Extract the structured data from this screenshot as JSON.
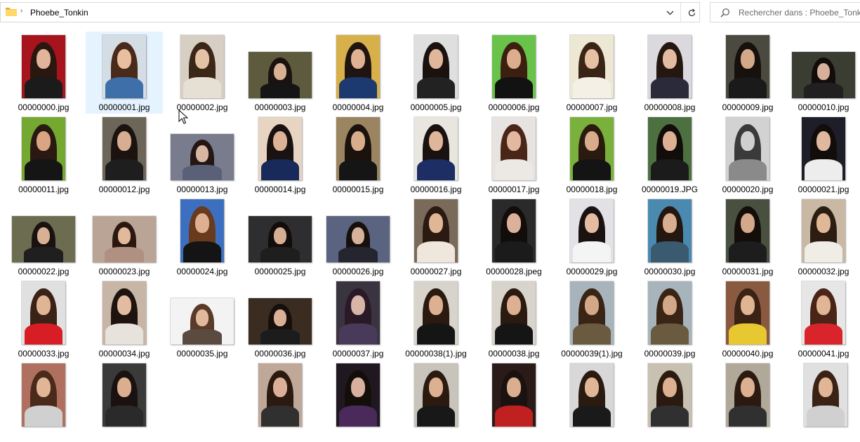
{
  "address": {
    "folder_icon": "folder-icon",
    "breadcrumb": "Phoebe_Tonkin"
  },
  "search": {
    "placeholder": "Rechercher dans : Phoebe_Tonkin"
  },
  "colors": {
    "selection": "#e5f3ff",
    "folder": "#f4c64d"
  },
  "files": [
    {
      "name": "00000000.jpg",
      "bg": "#a8141e",
      "skin": "#e2b49a",
      "hair": "#2a1710",
      "top": "#1b1b1b",
      "thumb": "p"
    },
    {
      "name": "00000001.jpg",
      "bg": "#d4dde4",
      "skin": "#eabf9f",
      "hair": "#4a2a1a",
      "top": "#3f6fa8",
      "thumb": "p",
      "selected": true
    },
    {
      "name": "00000002.jpg",
      "bg": "#d8cfc4",
      "skin": "#e4c2a6",
      "hair": "#3a2718",
      "top": "#e6e0d4",
      "thumb": "p"
    },
    {
      "name": "00000003.jpg",
      "bg": "#5e5a3e",
      "skin": "#d8b094",
      "hair": "#1a1210",
      "top": "#151515",
      "thumb": "l"
    },
    {
      "name": "00000004.jpg",
      "bg": "#d8b04a",
      "skin": "#deb293",
      "hair": "#1f1410",
      "top": "#1d3a70",
      "thumb": "p"
    },
    {
      "name": "00000005.jpg",
      "bg": "#dfdfdf",
      "skin": "#e1b79b",
      "hair": "#1b1210",
      "top": "#222222",
      "thumb": "p"
    },
    {
      "name": "00000006.jpg",
      "bg": "#69c24a",
      "skin": "#ddae8e",
      "hair": "#3b2012",
      "top": "#121212",
      "thumb": "p"
    },
    {
      "name": "00000007.jpg",
      "bg": "#ece8d4",
      "skin": "#e6c1a3",
      "hair": "#3a2416",
      "top": "#f4f0e6",
      "thumb": "p"
    },
    {
      "name": "00000008.jpg",
      "bg": "#dcd9de",
      "skin": "#e3bba0",
      "hair": "#24170f",
      "top": "#2a2a3a",
      "thumb": "p"
    },
    {
      "name": "00000009.jpg",
      "bg": "#4b4a40",
      "skin": "#d4a98a",
      "hair": "#17100c",
      "top": "#1a1a1a",
      "thumb": "p"
    },
    {
      "name": "00000010.jpg",
      "bg": "#3a3d32",
      "skin": "#d6b09a",
      "hair": "#120d0b",
      "top": "#202020",
      "thumb": "l"
    },
    {
      "name": "00000011.jpg",
      "bg": "#74a830",
      "skin": "#d9a582",
      "hair": "#2a1912",
      "top": "#151515",
      "thumb": "p"
    },
    {
      "name": "00000012.jpg",
      "bg": "#6c6658",
      "skin": "#d7ae91",
      "hair": "#1b1310",
      "top": "#1e1e1e",
      "thumb": "p"
    },
    {
      "name": "00000013.jpg",
      "bg": "#787c8c",
      "skin": "#d9b6a1",
      "hair": "#241614",
      "top": "#5a6078",
      "thumb": "l"
    },
    {
      "name": "00000014.jpg",
      "bg": "#e8d4c2",
      "skin": "#ddb397",
      "hair": "#1a1210",
      "top": "#182a5a",
      "thumb": "p"
    },
    {
      "name": "00000015.jpg",
      "bg": "#9a8560",
      "skin": "#d7ad8c",
      "hair": "#1b120e",
      "top": "#151515",
      "thumb": "p"
    },
    {
      "name": "00000016.jpg",
      "bg": "#e9e6e0",
      "skin": "#e0b69b",
      "hair": "#1a1210",
      "top": "#1d2e64",
      "thumb": "p"
    },
    {
      "name": "00000017.jpg",
      "bg": "#e7e3e0",
      "skin": "#e2b8a0",
      "hair": "#4a2618",
      "top": "#ece8e4",
      "thumb": "p"
    },
    {
      "name": "00000018.jpg",
      "bg": "#7ab03c",
      "skin": "#d8ab8d",
      "hair": "#2a1a10",
      "top": "#141414",
      "thumb": "p"
    },
    {
      "name": "00000019.JPG",
      "bg": "#4c7040",
      "skin": "#dcb092",
      "hair": "#120c0a",
      "top": "#1b1b1b",
      "thumb": "p"
    },
    {
      "name": "00000020.jpg",
      "bg": "#d2d2d2",
      "skin": "#cfcfcf",
      "hair": "#3a3a3a",
      "top": "#8a8a8a",
      "thumb": "p"
    },
    {
      "name": "00000021.jpg",
      "bg": "#1e1e28",
      "skin": "#e0b8a0",
      "hair": "#120d0b",
      "top": "#ededed",
      "thumb": "p"
    },
    {
      "name": "00000022.jpg",
      "bg": "#6c6c50",
      "skin": "#d7b096",
      "hair": "#1a1210",
      "top": "#1f1f1f",
      "thumb": "l"
    },
    {
      "name": "00000023.jpg",
      "bg": "#b9a496",
      "skin": "#e1b99d",
      "hair": "#2a1810",
      "top": "#b09080",
      "thumb": "l"
    },
    {
      "name": "00000024.jpg",
      "bg": "#3c6fc0",
      "skin": "#deb091",
      "hair": "#6a3a1e",
      "top": "#141414",
      "thumb": "p"
    },
    {
      "name": "00000025.jpg",
      "bg": "#2e2e30",
      "skin": "#d5ad92",
      "hair": "#120c0a",
      "top": "#1e1e1e",
      "thumb": "l"
    },
    {
      "name": "00000026.jpg",
      "bg": "#5a6480",
      "skin": "#d6b19c",
      "hair": "#170f0c",
      "top": "#252530",
      "thumb": "l"
    },
    {
      "name": "00000027.jpg",
      "bg": "#7a6a5a",
      "skin": "#e0b697",
      "hair": "#2a1a12",
      "top": "#efe6dc",
      "thumb": "p"
    },
    {
      "name": "00000028.jpeg",
      "bg": "#2a2a2a",
      "skin": "#dcb199",
      "hair": "#120c0a",
      "top": "#1b1b1b",
      "thumb": "p"
    },
    {
      "name": "00000029.jpg",
      "bg": "#e2e2e6",
      "skin": "#e3bca2",
      "hair": "#1a1210",
      "top": "#f4f4f4",
      "thumb": "p"
    },
    {
      "name": "00000030.jpg",
      "bg": "#4a8ab0",
      "skin": "#d8ad90",
      "hair": "#24170f",
      "top": "#3a5a70",
      "thumb": "p"
    },
    {
      "name": "00000031.jpg",
      "bg": "#4a5040",
      "skin": "#d3a98a",
      "hair": "#140e0b",
      "top": "#1d1d1d",
      "thumb": "p"
    },
    {
      "name": "00000032.jpg",
      "bg": "#c8b8a4",
      "skin": "#e0b897",
      "hair": "#2c1d13",
      "top": "#f0ece6",
      "thumb": "p"
    },
    {
      "name": "00000033.jpg",
      "bg": "#e0e0e0",
      "skin": "#e0b595",
      "hair": "#3a2216",
      "top": "#d81e24",
      "thumb": "p"
    },
    {
      "name": "00000034.jpg",
      "bg": "#c7b6a6",
      "skin": "#e3bba0",
      "hair": "#1e130e",
      "top": "#e8e2dc",
      "thumb": "p"
    },
    {
      "name": "00000035.jpg",
      "bg": "#f3f3f3",
      "skin": "#e1b99d",
      "hair": "#5a3a28",
      "top": "#5a4a40",
      "thumb": "l"
    },
    {
      "name": "00000036.jpg",
      "bg": "#3a2c20",
      "skin": "#d9b096",
      "hair": "#170f0c",
      "top": "#1c1c1c",
      "thumb": "l"
    },
    {
      "name": "00000037.jpg",
      "bg": "#3a3440",
      "skin": "#d7b6a8",
      "hair": "#2a1a28",
      "top": "#4a3a5a",
      "thumb": "p"
    },
    {
      "name": "00000038(1).jpg",
      "bg": "#d8d4cc",
      "skin": "#dcb090",
      "hair": "#2a1a10",
      "top": "#151515",
      "thumb": "p"
    },
    {
      "name": "00000038.jpg",
      "bg": "#d8d4cc",
      "skin": "#dcb090",
      "hair": "#2a1a10",
      "top": "#151515",
      "thumb": "p"
    },
    {
      "name": "00000039(1).jpg",
      "bg": "#a8b4bc",
      "skin": "#d2a888",
      "hair": "#3a2416",
      "top": "#6a5a40",
      "thumb": "p"
    },
    {
      "name": "00000039.jpg",
      "bg": "#a8b4bc",
      "skin": "#d2a888",
      "hair": "#3a2416",
      "top": "#6a5a40",
      "thumb": "p"
    },
    {
      "name": "00000040.jpg",
      "bg": "#8a5a40",
      "skin": "#e0b593",
      "hair": "#3a2214",
      "top": "#e8c830",
      "thumb": "p"
    },
    {
      "name": "00000041.jpg",
      "bg": "#e6e6e6",
      "skin": "#e0b696",
      "hair": "#4a2416",
      "top": "#d8242a",
      "thumb": "p"
    },
    {
      "name": "",
      "bg": "#b07060",
      "skin": "#e0b696",
      "hair": "#4a2a1a",
      "top": "#d0d0d0",
      "thumb": "p"
    },
    {
      "name": "",
      "bg": "#3a3a3a",
      "skin": "#dcae90",
      "hair": "#1a1210",
      "top": "#2a2a2a",
      "thumb": "p"
    },
    {
      "name": "",
      "bg": "#ffffff",
      "skin": "#ffffff",
      "hair": "#ffffff",
      "top": "#ffffff",
      "thumb": "none"
    },
    {
      "name": "",
      "bg": "#c0a898",
      "skin": "#dcb098",
      "hair": "#2a1a10",
      "top": "#303030",
      "thumb": "p"
    },
    {
      "name": "",
      "bg": "#201820",
      "skin": "#d8b0a0",
      "hair": "#140e0b",
      "top": "#4a2a5a",
      "thumb": "p"
    },
    {
      "name": "",
      "bg": "#c8c4bc",
      "skin": "#dcb090",
      "hair": "#2a1a10",
      "top": "#181818",
      "thumb": "p"
    },
    {
      "name": "",
      "bg": "#2a1a18",
      "skin": "#dcae90",
      "hair": "#1a1210",
      "top": "#c02020",
      "thumb": "p"
    },
    {
      "name": "",
      "bg": "#d8d8d8",
      "skin": "#e0b696",
      "hair": "#2a1a10",
      "top": "#1a1a1a",
      "thumb": "p"
    },
    {
      "name": "",
      "bg": "#c8c0b0",
      "skin": "#dcb090",
      "hair": "#2a1a10",
      "top": "#303030",
      "thumb": "p"
    },
    {
      "name": "",
      "bg": "#b0a898",
      "skin": "#dcb090",
      "hair": "#2a1a10",
      "top": "#303030",
      "thumb": "p"
    },
    {
      "name": "",
      "bg": "#e0e0e0",
      "skin": "#e0b696",
      "hair": "#3a2214",
      "top": "#d0d0d0",
      "thumb": "p"
    }
  ]
}
